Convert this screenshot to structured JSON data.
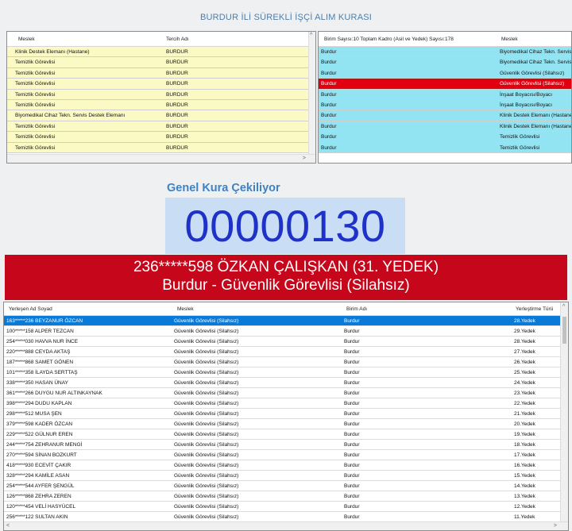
{
  "app": {
    "title": "BURDUR İLİ SÜREKLİ İŞÇİ ALIM KURASI"
  },
  "left_grid": {
    "headers": {
      "col1": "Meslek",
      "col2": "Tercih Adı"
    },
    "rows": [
      {
        "meslek": "Klinik Destek Elemanı (Hastane)",
        "tercih": "BURDUR"
      },
      {
        "meslek": "Temizlik Görevlisi",
        "tercih": "BURDUR"
      },
      {
        "meslek": "Temizlik Görevlisi",
        "tercih": "BURDUR"
      },
      {
        "meslek": "Temizlik Görevlisi",
        "tercih": "BURDUR"
      },
      {
        "meslek": "Temizlik Görevlisi",
        "tercih": "BURDUR"
      },
      {
        "meslek": "Temizlik Görevlisi",
        "tercih": "BURDUR"
      },
      {
        "meslek": "Biyomedikal Cihaz Tekn. Servis Destek Elemanı",
        "tercih": "BURDUR"
      },
      {
        "meslek": "Temizlik Görevlisi",
        "tercih": "BURDUR"
      },
      {
        "meslek": "Temizlik Görevlisi",
        "tercih": "BURDUR"
      },
      {
        "meslek": "Temizlik Görevlisi",
        "tercih": "BURDUR"
      }
    ]
  },
  "right_grid": {
    "headers": {
      "col1": "Birim Sayısı:10 Toplam Kadro (Asil ve Yedek) Sayısı:178",
      "col2": "Meslek"
    },
    "rows": [
      {
        "birim": "Burdur",
        "meslek": "Biyomedikal Cihaz Tekn. Servis"
      },
      {
        "birim": "Burdur",
        "meslek": "Biyomedikal Cihaz Tekn. Servis"
      },
      {
        "birim": "Burdur",
        "meslek": "Güvenlik Görevlisi (Silahsız)"
      },
      {
        "birim": "Burdur",
        "meslek": "Güvenlik Görevlisi (Silahsız)",
        "selected": true
      },
      {
        "birim": "Burdur",
        "meslek": "İnşaat Boyacısı/Boyacı"
      },
      {
        "birim": "Burdur",
        "meslek": "İnşaat Boyacısı/Boyacı"
      },
      {
        "birim": "Burdur",
        "meslek": "Klinik Destek Elemanı (Hastane)"
      },
      {
        "birim": "Burdur",
        "meslek": "Klinik Destek Elemanı (Hastane)"
      },
      {
        "birim": "Burdur",
        "meslek": "Temizlik Görevlisi"
      },
      {
        "birim": "Burdur",
        "meslek": "Temizlik Görevlisi"
      }
    ]
  },
  "draw": {
    "status": "Genel Kura Çekiliyor",
    "counter": "00000130",
    "winner_line1": "236*****598 ÖZKAN ÇALIŞKAN (31. YEDEK)",
    "winner_line2": "Burdur - Güvenlik Görevlisi (Silahsız)"
  },
  "results_grid": {
    "headers": {
      "col1": "Yerleşen Ad Soyad",
      "col2": "Meslek",
      "col3": "Birim Adı",
      "col4": "Yerleştirme Türü"
    },
    "rows": [
      {
        "ad": "163*****236 BEYZANUR ÖZCAN",
        "meslek": "Güvenlik Görevlisi (Silahsız)",
        "birim": "Burdur",
        "tur": "28.Yedek",
        "selected": true
      },
      {
        "ad": "100*****158 ALPER TEZCAN",
        "meslek": "Güvenlik Görevlisi (Silahsız)",
        "birim": "Burdur",
        "tur": "29.Yedek"
      },
      {
        "ad": "254*****030 HAVVA NUR İNCE",
        "meslek": "Güvenlik Görevlisi (Silahsız)",
        "birim": "Burdur",
        "tur": "28.Yedek"
      },
      {
        "ad": "220*****888 CEYDA AKTAŞ",
        "meslek": "Güvenlik Görevlisi (Silahsız)",
        "birim": "Burdur",
        "tur": "27.Yedek"
      },
      {
        "ad": "187*****868 SAMET GÖNEN",
        "meslek": "Güvenlik Görevlisi (Silahsız)",
        "birim": "Burdur",
        "tur": "26.Yedek"
      },
      {
        "ad": "101*****358 İLAYDA SERTTAŞ",
        "meslek": "Güvenlik Görevlisi (Silahsız)",
        "birim": "Burdur",
        "tur": "25.Yedek"
      },
      {
        "ad": "338*****350 HASAN ÜNAY",
        "meslek": "Güvenlik Görevlisi (Silahsız)",
        "birim": "Burdur",
        "tur": "24.Yedek"
      },
      {
        "ad": "361*****266 DUYGU NUR ALTINKAYNAK",
        "meslek": "Güvenlik Görevlisi (Silahsız)",
        "birim": "Burdur",
        "tur": "23.Yedek"
      },
      {
        "ad": "398*****294 DUDU KAPLAN",
        "meslek": "Güvenlik Görevlisi (Silahsız)",
        "birim": "Burdur",
        "tur": "22.Yedek"
      },
      {
        "ad": "298*****512 MUSA ŞEN",
        "meslek": "Güvenlik Görevlisi (Silahsız)",
        "birim": "Burdur",
        "tur": "21.Yedek"
      },
      {
        "ad": "379*****598 KADER ÖZCAN",
        "meslek": "Güvenlik Görevlisi (Silahsız)",
        "birim": "Burdur",
        "tur": "20.Yedek"
      },
      {
        "ad": "229*****522 GÜLNUR EREN",
        "meslek": "Güvenlik Görevlisi (Silahsız)",
        "birim": "Burdur",
        "tur": "19.Yedek"
      },
      {
        "ad": "244*****754 ZEHRANUR MENGİ",
        "meslek": "Güvenlik Görevlisi (Silahsız)",
        "birim": "Burdur",
        "tur": "18.Yedek"
      },
      {
        "ad": "270*****594 SİNAN BOZKURT",
        "meslek": "Güvenlik Görevlisi (Silahsız)",
        "birim": "Burdur",
        "tur": "17.Yedek"
      },
      {
        "ad": "418*****930 ECEVİT ÇAKIR",
        "meslek": "Güvenlik Görevlisi (Silahsız)",
        "birim": "Burdur",
        "tur": "16.Yedek"
      },
      {
        "ad": "328*****294 KAMİLE ASAN",
        "meslek": "Güvenlik Görevlisi (Silahsız)",
        "birim": "Burdur",
        "tur": "15.Yedek"
      },
      {
        "ad": "254*****544 AYFER ŞENGÜL",
        "meslek": "Güvenlik Görevlisi (Silahsız)",
        "birim": "Burdur",
        "tur": "14.Yedek"
      },
      {
        "ad": "126*****868 ZEHRA ZEREN",
        "meslek": "Güvenlik Görevlisi (Silahsız)",
        "birim": "Burdur",
        "tur": "13.Yedek"
      },
      {
        "ad": "120*****454 VELİ HASYÜCEL",
        "meslek": "Güvenlik Görevlisi (Silahsız)",
        "birim": "Burdur",
        "tur": "12.Yedek"
      },
      {
        "ad": "256*****122 SULTAN AKIN",
        "meslek": "Güvenlik Görevlisi (Silahsız)",
        "birim": "Burdur",
        "tur": "11.Yedek"
      }
    ]
  },
  "colors": {
    "left_row_bg": "#fbf9c4",
    "right_row_bg": "#93e4f3",
    "selected_red": "#e0000f",
    "winner_banner": "#c6061a",
    "counter_text": "#1e31c8",
    "selected_blue": "#0a7ad8"
  },
  "icons": {
    "scroll_up": "chevron-up-icon",
    "scroll_down": "chevron-down-icon",
    "scroll_left": "chevron-left-icon",
    "scroll_right": "chevron-right-icon"
  }
}
